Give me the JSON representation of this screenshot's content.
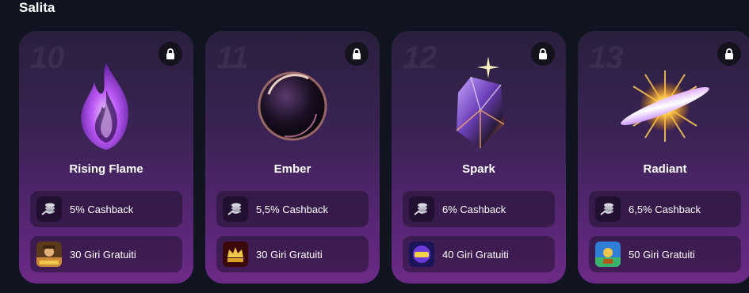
{
  "section": {
    "title": "Salita"
  },
  "colors": {
    "background": "#0f1420",
    "card_top": "#2a1f3d",
    "card_bottom": "#6d2a88",
    "lock_bg": "#14121c"
  },
  "cards": [
    {
      "level": "10",
      "name": "Rising Flame",
      "emblem": "flame-icon",
      "cashback": "5% Cashback",
      "spins": "30 Giri Gratuiti",
      "game_thumb": "wild-west-game-thumb"
    },
    {
      "level": "11",
      "name": "Ember",
      "emblem": "orb-icon",
      "cashback": "5,5% Cashback",
      "spins": "30 Giri Gratuiti",
      "game_thumb": "lucky-crown-game-thumb"
    },
    {
      "level": "12",
      "name": "Spark",
      "emblem": "crystal-icon",
      "cashback": "6% Cashback",
      "spins": "40 Giri Gratuiti",
      "game_thumb": "cash-game-thumb"
    },
    {
      "level": "13",
      "name": "Radiant",
      "emblem": "radiant-icon",
      "cashback": "6,5% Cashback",
      "spins": "50 Giri Gratuiti",
      "game_thumb": "treasure-game-thumb"
    }
  ]
}
